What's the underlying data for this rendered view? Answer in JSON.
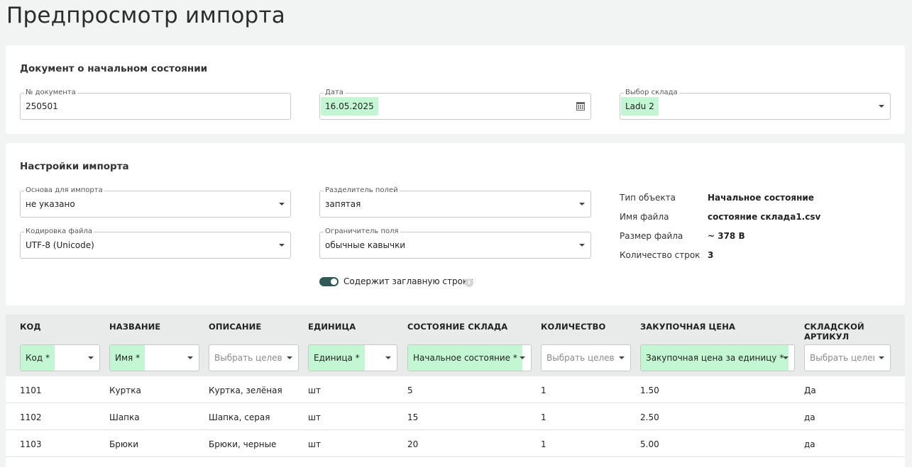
{
  "title": "Предпросмотр импорта",
  "document": {
    "heading": "Документ о начальном состоянии",
    "doc_number": {
      "label": "№ документа",
      "value": "250501"
    },
    "date": {
      "label": "Дата",
      "value": "16.05.2025",
      "icon": "calendar-icon"
    },
    "warehouse": {
      "label": "Выбор склада",
      "value": "Ladu 2"
    }
  },
  "settings": {
    "heading": "Настройки импорта",
    "basis": {
      "label": "Основа для импорта",
      "value": "не указано"
    },
    "separator": {
      "label": "Разделитель полей",
      "value": "запятая"
    },
    "encoding": {
      "label": "Кодировка файла",
      "value": "UTF-8 (Unicode)"
    },
    "delimiter": {
      "label": "Ограничитель поля",
      "value": "обычные кавычки"
    },
    "header_toggle": {
      "label": "Содержит заглавную строку",
      "on": true,
      "info": "i"
    },
    "info": [
      {
        "key": "Тип объекта",
        "value": "Начальное состояние"
      },
      {
        "key": "Имя файла",
        "value": "состояние склада1.csv"
      },
      {
        "key": "Размер файла",
        "value": "~ 378 B"
      },
      {
        "key": "Количество строк",
        "value": "3"
      }
    ]
  },
  "table": {
    "columns": [
      {
        "header": "КОД",
        "mapping": "Код *",
        "mapped": true
      },
      {
        "header": "НАЗВАНИЕ",
        "mapping": "Имя *",
        "mapped": true
      },
      {
        "header": "ОПИСАНИЕ",
        "mapping": "Выбрать целевое поле",
        "mapped": false
      },
      {
        "header": "ЕДИНИЦА",
        "mapping": "Единица *",
        "mapped": true
      },
      {
        "header": "СОСТОЯНИЕ СКЛАДА",
        "mapping": "Начальное состояние *",
        "mapped": true
      },
      {
        "header": "КОЛИЧЕСТВО",
        "mapping": "Выбрать целевое поле",
        "mapped": false
      },
      {
        "header": "ЗАКУПОЧНАЯ ЦЕНА",
        "mapping": "Закупочная цена за единицу *",
        "mapped": true
      },
      {
        "header": "СКЛАДСКОЙ АРТИКУЛ",
        "mapping": "Выбрать целевое поле",
        "mapped": false
      }
    ],
    "rows": [
      [
        "1101",
        "Куртка",
        "Куртка, зелёная",
        "шт",
        "5",
        "1",
        "1.50",
        "Да"
      ],
      [
        "1102",
        "Шапка",
        "Шапка, серая",
        "шт",
        "15",
        "1",
        "2.50",
        "да"
      ],
      [
        "1103",
        "Брюки",
        "Брюки, черные",
        "шт",
        "20",
        "1",
        "5.00",
        "да"
      ]
    ]
  },
  "colors": {
    "mapped_highlight": "#c3f7d3",
    "toggle_on": "#2f5a55"
  }
}
